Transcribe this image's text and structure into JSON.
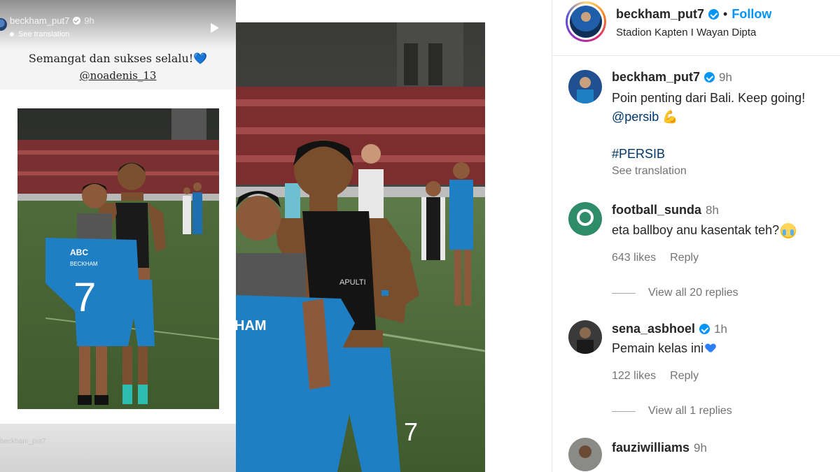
{
  "story": {
    "username": "beckham_put7",
    "time": "9h",
    "see_translation": "See translation",
    "caption": "Semangat dan sukses selalu!",
    "caption_emoji": "💙",
    "mention": "@noadenis_13",
    "footer_username": "beckham_put7",
    "jersey_sponsor": "ABC",
    "jersey_name": "BECKHAM",
    "jersey_number": "7",
    "icons": [
      "verified-icon",
      "play-icon"
    ]
  },
  "photo": {
    "jersey_fragment": "HAM",
    "shirt_sponsor": "APULTI",
    "shorts_number": "7"
  },
  "post": {
    "username": "beckham_put7",
    "separator": "•",
    "follow_label": "Follow",
    "location": "Stadion Kapten I Wayan Dipta"
  },
  "comments": [
    {
      "username": "beckham_put7",
      "verified": true,
      "time": "9h",
      "text": "Poin penting dari Bali. Keep going!",
      "mention": "@persib",
      "hashtag": "#PERSIB",
      "see_translation": "See translation"
    },
    {
      "username": "football_sunda",
      "verified": false,
      "time": "8h",
      "text": "eta ballboy anu kasentak teh?",
      "likes": "643 likes",
      "reply_label": "Reply",
      "view_replies": "View all 20 replies"
    },
    {
      "username": "sena_asbhoel",
      "verified": true,
      "time": "1h",
      "text": "Pemain kelas ini",
      "likes": "122 likes",
      "reply_label": "Reply",
      "view_replies": "View all 1 replies"
    },
    {
      "username": "fauziwilliams",
      "verified": false,
      "time": "9h"
    }
  ],
  "colors": {
    "link": "#00376b",
    "follow": "#0095f6",
    "verified": "#0095f6",
    "muted": "#737373",
    "jersey": "#1f7fc4"
  }
}
